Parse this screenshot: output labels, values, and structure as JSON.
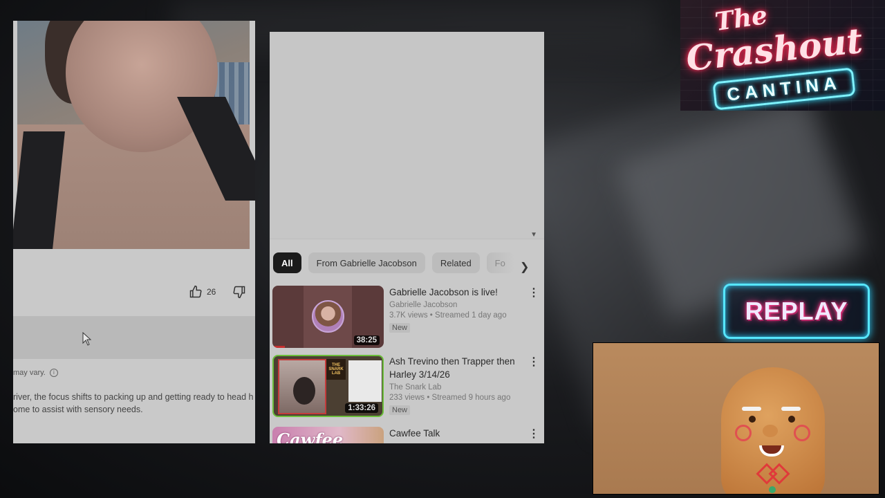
{
  "left_panel": {
    "likes": {
      "count": "26"
    },
    "note": "may vary.",
    "description_lines": [
      "river, the focus shifts to packing up and getting ready to head h",
      "ome to assist with sensory needs."
    ]
  },
  "related": {
    "chips": [
      {
        "label": "All",
        "active": true
      },
      {
        "label": "From Gabrielle Jacobson",
        "active": false
      },
      {
        "label": "Related",
        "active": false
      },
      {
        "label": "Fo",
        "active": false
      }
    ],
    "videos": [
      {
        "title": "Gabrielle Jacobson is live!",
        "channel": "Gabrielle Jacobson",
        "stats": "3.7K views • Streamed 1 day ago",
        "badge": "New",
        "duration": "38:25"
      },
      {
        "title": "Ash Trevino then Trapper then Harley 3/14/26",
        "channel": "The Snark Lab",
        "stats": "233 views • Streamed 9 hours ago",
        "badge": "New",
        "duration": "1:33:26"
      },
      {
        "title": "Cawfee Talk",
        "thumb_text": "Cawfee"
      }
    ],
    "thumb2_logo": "THE SNARK LAB"
  },
  "overlays": {
    "logo": {
      "the": "The",
      "main": "Crashout",
      "sub": "CANTINA"
    },
    "replay": "REPLAY"
  },
  "colors": {
    "panel_bg": "#c9c9c9",
    "neon_pink": "#ff2a55",
    "neon_cyan": "#33e0ff"
  },
  "icons": [
    "thumbs-up-icon",
    "thumbs-down-icon",
    "info-icon",
    "chevron-right-icon",
    "kebab-menu-icon",
    "mouse-cursor-icon",
    "caret-down-icon"
  ]
}
